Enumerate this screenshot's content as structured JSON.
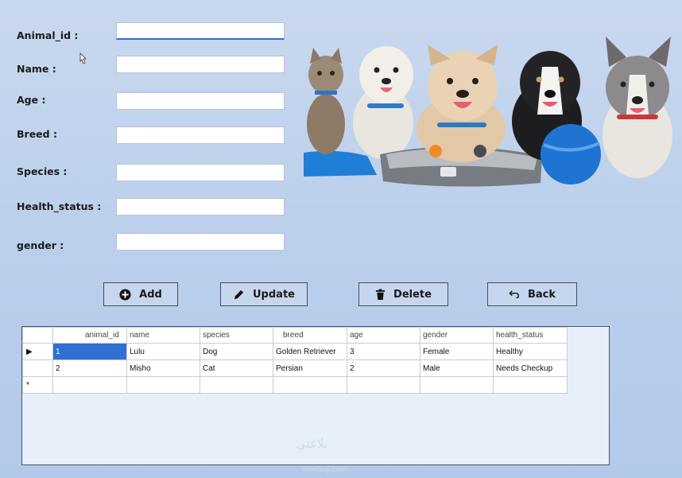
{
  "form": {
    "fields": [
      {
        "label": "Animal_id :",
        "value": ""
      },
      {
        "label": "Name :",
        "value": ""
      },
      {
        "label": "Age :",
        "value": ""
      },
      {
        "label": "Breed :",
        "value": ""
      },
      {
        "label": "Species :",
        "value": ""
      },
      {
        "label": "Health_status :",
        "value": ""
      },
      {
        "label": "gender :",
        "value": ""
      }
    ]
  },
  "buttons": {
    "add": "Add",
    "update": "Update",
    "delete": "Delete",
    "back": "Back"
  },
  "grid": {
    "columns": [
      "animal_id",
      "name",
      "species",
      "breed",
      "age",
      "gender",
      "health_status"
    ],
    "rows": [
      [
        "1",
        "Lulu",
        "Dog",
        "Golden Retriever",
        "3",
        "Female",
        "Healthy"
      ],
      [
        "2",
        "Misho",
        "Cat",
        "Persian",
        "2",
        "Male",
        "Needs Checkup"
      ]
    ],
    "new_row_marker": "*",
    "current_row_marker": "▶"
  },
  "watermark": {
    "arabic": "بلاغتي",
    "url": "mostaql.com"
  },
  "image_alt": "cat and dogs with toys",
  "colors": {
    "selection": "#2f6fd6",
    "background": "#c2d4ec"
  }
}
